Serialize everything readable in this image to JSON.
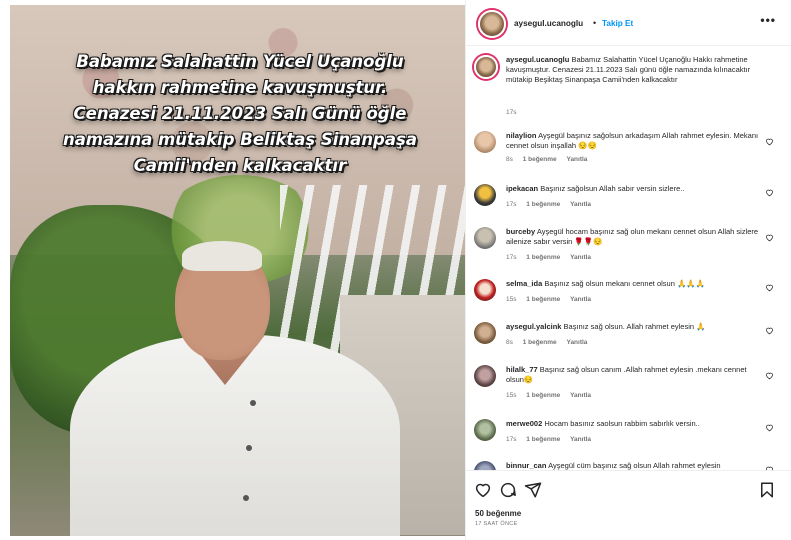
{
  "photo": {
    "caption_lines": [
      "Babamız Salahattin Yücel Uçanoğlu",
      "hakkın rahmetine kavuşmuştur.",
      "Cenazesi 21.11.2023 Salı Günü öğle",
      "namazına mütakip Beliktaş Sinanpaşa",
      "Camii'nden kalkacaktır"
    ]
  },
  "header": {
    "username": "aysegul.ucanoglu",
    "separator": "•",
    "follow_label": "Takip Et",
    "more_label": "•••"
  },
  "post": {
    "username": "aysegul.ucanoglu",
    "text": "Babamız Salahattin Yücel Uçanoğlu Hakkı rahmetine kavuşmuştur. Cenazesi 21.11.2023 Salı günü öğle namazında kılınacaktır mütakip Beşiktaş Sinanpaşa Camii'nden kalkacaktır",
    "time": "17s"
  },
  "comments": [
    {
      "username": "nilaylion",
      "text": "Ayşegül başınız sağolsun arkadaşım Allah rahmet eylesin. Mekanı cennet olsun inşallah 😔😔",
      "time": "8s",
      "likes": "1 beğenme",
      "reply": "Yanıtla"
    },
    {
      "username": "ipekacan",
      "text": "Başınız sağolsun Allah sabır versin sizlere..",
      "time": "17s",
      "likes": "1 beğenme",
      "reply": "Yanıtla"
    },
    {
      "username": "burceby",
      "text": "Ayşegül hocam başınız sağ olun mekanı cennet olsun Allah sizlere ailenize sabır versin 🌹🌹😔",
      "time": "17s",
      "likes": "1 beğenme",
      "reply": "Yanıtla"
    },
    {
      "username": "selma_ida",
      "text": "Başınız sağ olsun mekanı cennet olsun 🙏🙏🙏",
      "time": "15s",
      "likes": "1 beğenme",
      "reply": "Yanıtla"
    },
    {
      "username": "aysegul.yalcink",
      "text": "Başınız sağ olsun. Allah rahmet eylesin 🙏",
      "time": "8s",
      "likes": "1 beğenme",
      "reply": "Yanıtla"
    },
    {
      "username": "hilalk_77",
      "text": "Başınız sağ olsun canım .Allah rahmet eylesin .mekanı cennet olsun😔",
      "time": "15s",
      "likes": "1 beğenme",
      "reply": "Yanıtla"
    },
    {
      "username": "merwe002",
      "text": "Hocam basınız saolsun rabbim sabırlık versin..",
      "time": "17s",
      "likes": "1 beğenme",
      "reply": "Yanıtla"
    },
    {
      "username": "binnur_can",
      "text": "Ayşegül cüm başınız sağ olsun Allah rahmet eylesin",
      "time": "",
      "likes": "",
      "reply": ""
    }
  ],
  "footer": {
    "likes": "50 beğenme",
    "ago": "17 SAAT ÖNCE"
  },
  "icons": {
    "like": "heart-icon",
    "comment": "comment-icon",
    "share": "share-icon",
    "save": "bookmark-icon"
  }
}
